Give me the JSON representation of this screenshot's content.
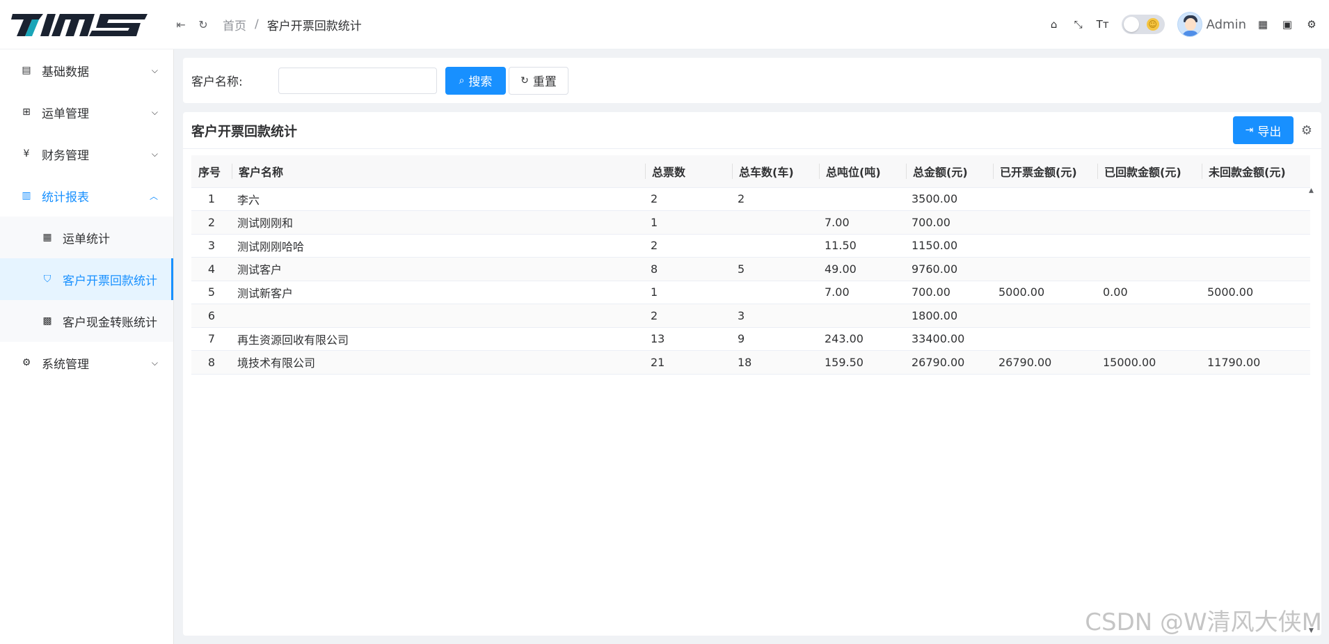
{
  "app": {
    "logo_text": "TIMS"
  },
  "header": {
    "breadcrumb_home": "首页",
    "breadcrumb_sep": "/",
    "breadcrumb_current": "客户开票回款统计",
    "user_name": "Admin"
  },
  "sidebar": {
    "items": [
      {
        "label": "基础数据"
      },
      {
        "label": "运单管理"
      },
      {
        "label": "财务管理"
      },
      {
        "label": "统计报表"
      },
      {
        "label": "系统管理"
      }
    ],
    "sub_items": [
      {
        "label": "运单统计"
      },
      {
        "label": "客户开票回款统计"
      },
      {
        "label": "客户现金转账统计"
      }
    ]
  },
  "search": {
    "label": "客户名称:",
    "placeholder": "",
    "search_btn": "搜索",
    "reset_btn": "重置"
  },
  "card": {
    "title": "客户开票回款统计",
    "export_btn": "导出"
  },
  "table": {
    "columns": [
      "序号",
      "客户名称",
      "总票数",
      "总车数(车)",
      "总吨位(吨)",
      "总金额(元)",
      "已开票金额(元)",
      "已回款金额(元)",
      "未回款金额(元)"
    ],
    "rows": [
      [
        "1",
        "李六",
        "2",
        "2",
        "",
        "3500.00",
        "",
        "",
        ""
      ],
      [
        "2",
        "测试刚刚和",
        "1",
        "",
        "7.00",
        "700.00",
        "",
        "",
        ""
      ],
      [
        "3",
        "测试刚刚哈哈",
        "2",
        "",
        "11.50",
        "1150.00",
        "",
        "",
        ""
      ],
      [
        "4",
        "测试客户",
        "8",
        "5",
        "49.00",
        "9760.00",
        "",
        "",
        ""
      ],
      [
        "5",
        "测试新客户",
        "1",
        "",
        "7.00",
        "700.00",
        "5000.00",
        "0.00",
        "5000.00"
      ],
      [
        "6",
        "",
        "2",
        "3",
        "",
        "1800.00",
        "",
        "",
        ""
      ],
      [
        "7",
        "再生资源回收有限公司",
        "13",
        "9",
        "243.00",
        "33400.00",
        "",
        "",
        ""
      ],
      [
        "8",
        "境技术有限公司",
        "21",
        "18",
        "159.50",
        "26790.00",
        "26790.00",
        "15000.00",
        "11790.00"
      ]
    ]
  },
  "watermark": "CSDN @W清风大侠M",
  "colors": {
    "primary": "#1890ff",
    "sidebar_active_bg": "#e6f4ff"
  }
}
